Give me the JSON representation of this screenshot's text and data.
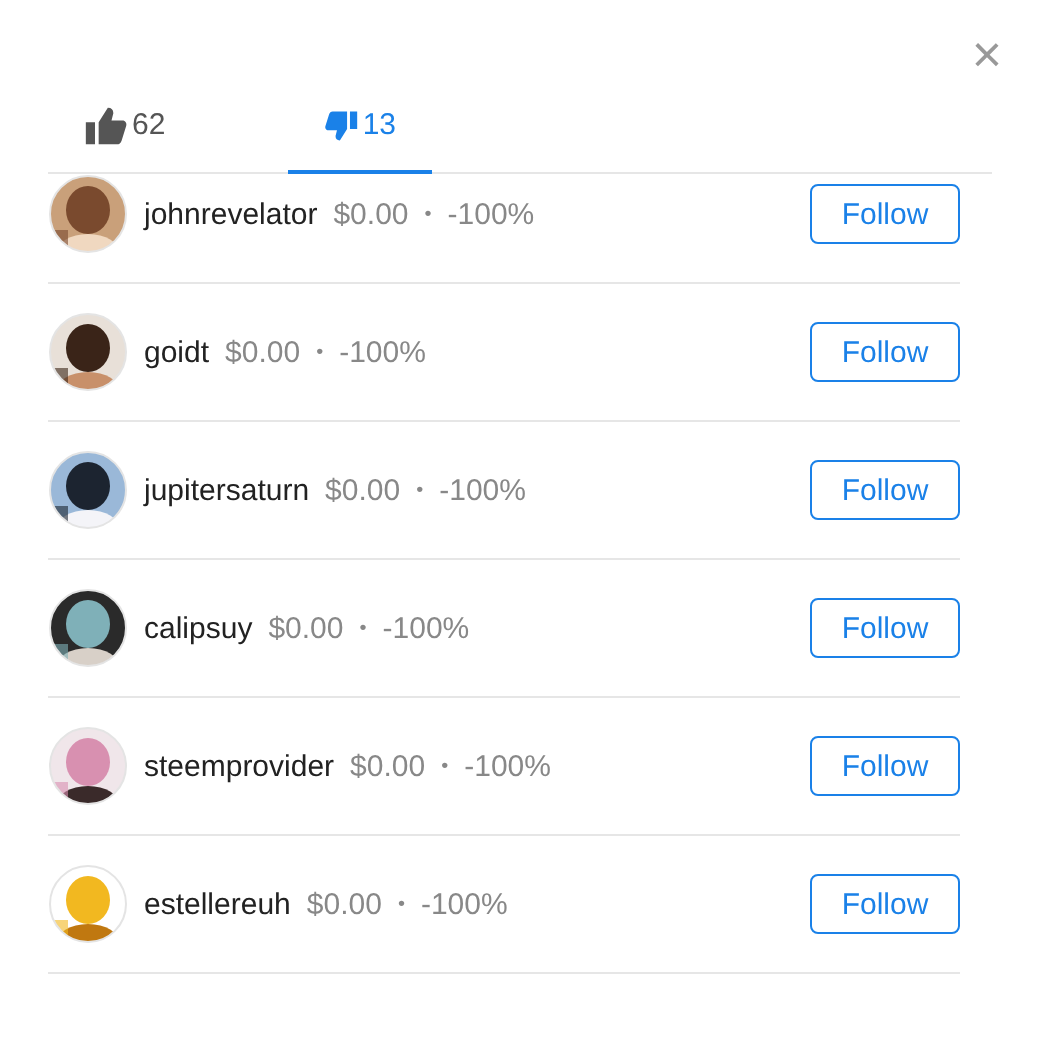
{
  "tabs": [
    {
      "kind": "up",
      "count": "62",
      "selected": false
    },
    {
      "kind": "down",
      "count": "13",
      "selected": true
    }
  ],
  "close": "×",
  "voters": [
    {
      "name": "johnrevelator",
      "amount": "$0.00",
      "separator": "•",
      "change": "-100%",
      "action": "Follow"
    },
    {
      "name": "goidt",
      "amount": "$0.00",
      "separator": "•",
      "change": "-100%",
      "action": "Follow"
    },
    {
      "name": "jupitersaturn",
      "amount": "$0.00",
      "separator": "•",
      "change": "-100%",
      "action": "Follow"
    },
    {
      "name": "calipsuy",
      "amount": "$0.00",
      "separator": "•",
      "change": "-100%",
      "action": "Follow"
    },
    {
      "name": "steemprovider",
      "amount": "$0.00",
      "separator": "•",
      "change": "-100%",
      "action": "Follow"
    },
    {
      "name": "estellereuh",
      "amount": "$0.00",
      "separator": "•",
      "change": "-100%",
      "action": "Follow"
    }
  ]
}
